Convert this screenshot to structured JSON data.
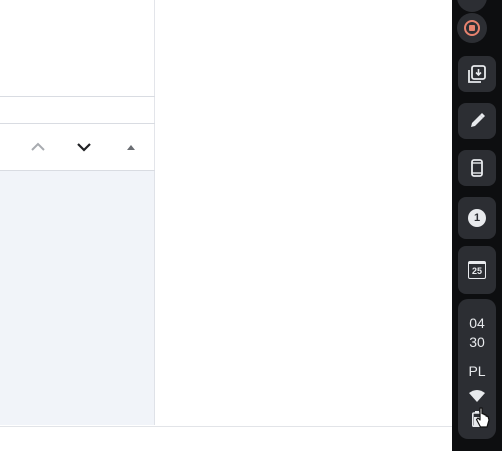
{
  "taskbar": {
    "calendar_date": "25",
    "notification_count": "1",
    "clock_hour": "04",
    "clock_minute": "30",
    "input_language": "PL"
  },
  "colors": {
    "taskbar_bg": "#0d0e10",
    "button_bg": "#2c2e33",
    "record_accent": "#e8836f",
    "content_bg": "#f1f4f9"
  },
  "icons": [
    "record-icon",
    "screenshot-icon",
    "pen-icon",
    "phone-icon",
    "notification-icon",
    "calendar-icon",
    "wifi-icon",
    "battery-icon",
    "chevron-up-icon",
    "chevron-down-icon",
    "triangle-up-icon"
  ]
}
